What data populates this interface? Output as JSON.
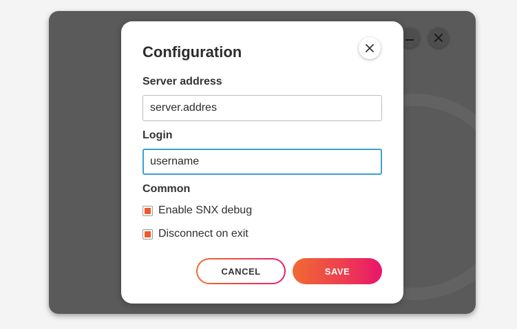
{
  "dialog": {
    "title": "Configuration",
    "server_label": "Server address",
    "server_value": "server.addres",
    "login_label": "Login",
    "login_value": "username",
    "common_label": "Common",
    "checkboxes": [
      {
        "label": "Enable SNX debug",
        "checked": true
      },
      {
        "label": "Disconnect on exit",
        "checked": true
      }
    ],
    "cancel_label": "CANCEL",
    "save_label": "SAVE"
  },
  "colors": {
    "accent_orange": "#ef5a2a",
    "accent_pink": "#e8156c",
    "focus_blue": "#3a9fd2",
    "backdrop": "#5a5a5a"
  },
  "icons": {
    "dialog_close": "close-icon",
    "window_minimize": "minimize-icon",
    "window_close": "close-icon"
  }
}
